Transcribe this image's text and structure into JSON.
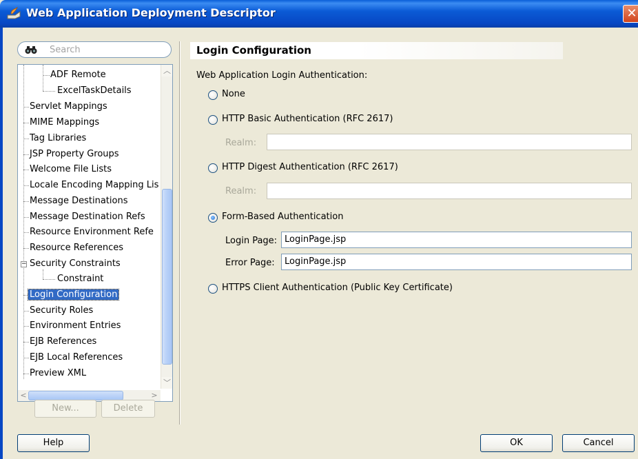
{
  "window": {
    "title": "Web Application Deployment Descriptor"
  },
  "search": {
    "placeholder": "Search",
    "value": ""
  },
  "tree": {
    "items": [
      {
        "label": "ADF Remote"
      },
      {
        "label": "ExcelTaskDetails"
      },
      {
        "label": "Servlet Mappings"
      },
      {
        "label": "MIME Mappings"
      },
      {
        "label": "Tag Libraries"
      },
      {
        "label": "JSP Property Groups"
      },
      {
        "label": "Welcome File Lists"
      },
      {
        "label": "Locale Encoding Mapping Lis"
      },
      {
        "label": "Message Destinations"
      },
      {
        "label": "Message Destination Refs"
      },
      {
        "label": "Resource Environment Refe"
      },
      {
        "label": "Resource References"
      },
      {
        "label": "Security Constraints"
      },
      {
        "label": "Constraint"
      },
      {
        "label": "Login Configuration"
      },
      {
        "label": "Security Roles"
      },
      {
        "label": "Environment Entries"
      },
      {
        "label": "EJB References"
      },
      {
        "label": "EJB Local References"
      },
      {
        "label": "Preview XML"
      }
    ],
    "selected": "Login Configuration"
  },
  "tree_buttons": {
    "new_label": "New...",
    "delete_label": "Delete"
  },
  "panel": {
    "title": "Login Configuration",
    "group_label": "Web Application Login Authentication:",
    "options": {
      "none": "None",
      "basic": "HTTP Basic Authentication (RFC 2617)",
      "digest": "HTTP Digest Authentication (RFC 2617)",
      "form": "Form-Based Authentication",
      "https": "HTTPS Client Authentication (Public Key Certificate)"
    },
    "selected_option": "form",
    "realm_label": "Realm:",
    "basic_realm_value": "",
    "digest_realm_value": "",
    "login_page_label": "Login Page:",
    "login_page_value": "LoginPage.jsp",
    "error_page_label": "Error Page:",
    "error_page_value": "LoginPage.jsp"
  },
  "footer": {
    "help_label": "Help",
    "ok_label": "OK",
    "cancel_label": "Cancel"
  },
  "colors": {
    "titlebar": "#0747c4",
    "selection": "#316ac5",
    "dialog_bg": "#ece9d8"
  }
}
